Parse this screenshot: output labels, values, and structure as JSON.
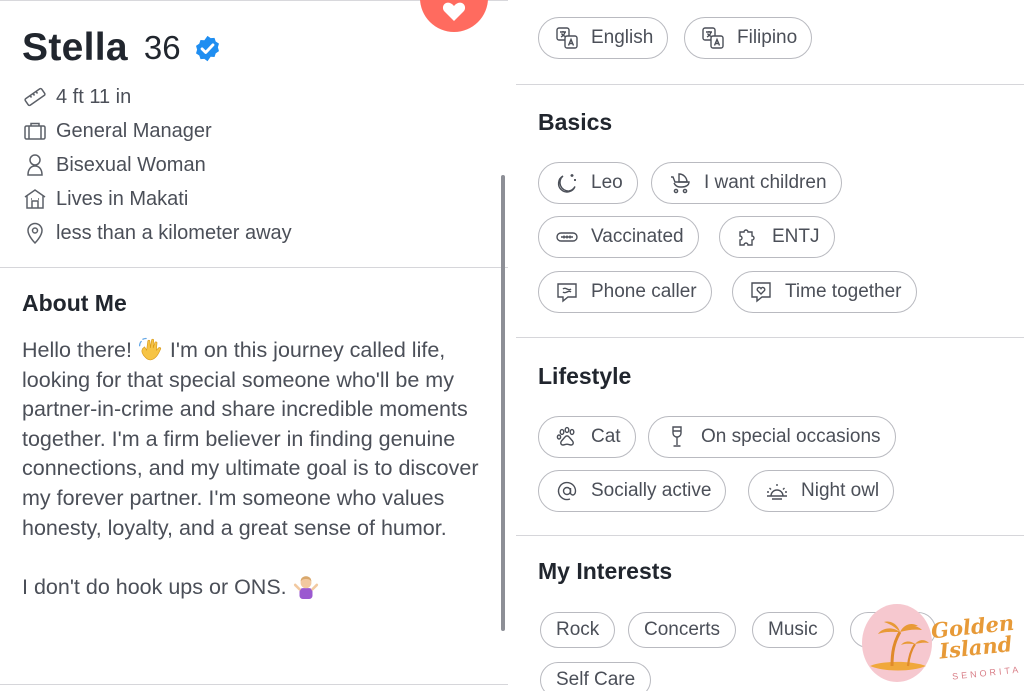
{
  "profile": {
    "name": "Stella",
    "age": "36",
    "facts": [
      {
        "icon": "ruler-icon",
        "text": "4 ft 11 in"
      },
      {
        "icon": "briefcase-icon",
        "text": "General Manager"
      },
      {
        "icon": "person-icon",
        "text": "Bisexual Woman"
      },
      {
        "icon": "house-icon",
        "text": "Lives in Makati"
      },
      {
        "icon": "location-pin-icon",
        "text": "less than a kilometer away"
      }
    ]
  },
  "about": {
    "title": "About Me",
    "paragraph1_before": "Hello there! ",
    "paragraph1_after": " I'm on this journey called life, looking for that special someone who'll be my partner-in-crime and share incredible moments together. I'm a firm believer in finding genuine connections, and my ultimate goal is to discover my forever partner. I'm someone who values honesty, loyalty, and a great sense of humor.",
    "paragraph2": "I don't do hook ups or ONS. "
  },
  "languages": [
    {
      "icon": "translate-icon",
      "label": "English"
    },
    {
      "icon": "translate-icon",
      "label": "Filipino"
    }
  ],
  "basics": {
    "title": "Basics",
    "items": [
      {
        "icon": "moon-stars-icon",
        "label": "Leo"
      },
      {
        "icon": "baby-stroller-icon",
        "label": "I want children"
      },
      {
        "icon": "syringe-icon",
        "label": "Vaccinated"
      },
      {
        "icon": "puzzle-icon",
        "label": "ENTJ"
      },
      {
        "icon": "chat-bubble-icon",
        "label": "Phone caller"
      },
      {
        "icon": "heart-bubble-icon",
        "label": "Time together"
      }
    ]
  },
  "lifestyle": {
    "title": "Lifestyle",
    "items": [
      {
        "icon": "paw-icon",
        "label": "Cat"
      },
      {
        "icon": "wine-glass-icon",
        "label": "On special occasions"
      },
      {
        "icon": "at-sign-icon",
        "label": "Socially active"
      },
      {
        "icon": "sunrise-icon",
        "label": "Night owl"
      }
    ]
  },
  "interests": {
    "title": "My Interests",
    "items": [
      "Rock",
      "Concerts",
      "Music",
      "Self Care"
    ]
  },
  "watermark": {
    "line1": "Golden",
    "line2": "Island",
    "line3": "SENORITA"
  },
  "colors": {
    "accent_like": "#ff6b5f",
    "verified_blue": "#1f8ef1",
    "pill_border": "#b9bac0",
    "text": "#4b4f58"
  }
}
